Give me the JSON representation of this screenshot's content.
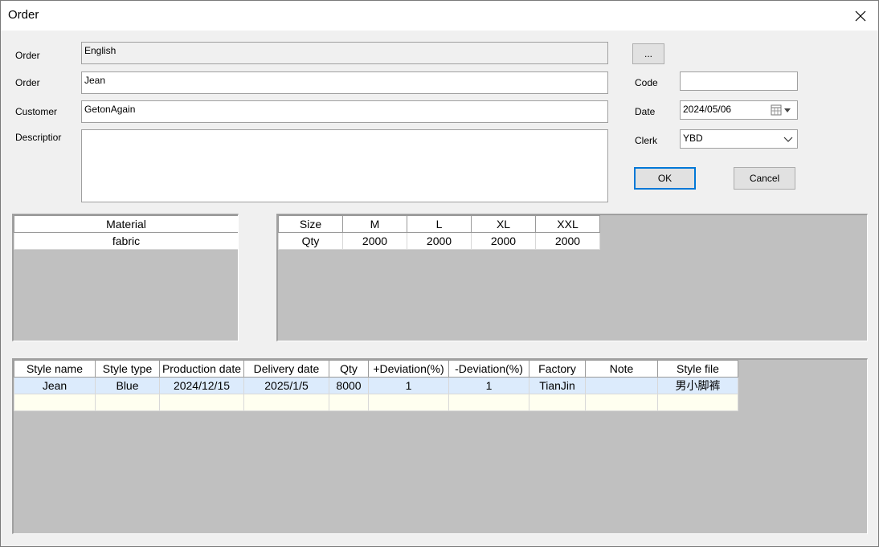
{
  "window": {
    "title": "Order"
  },
  "form": {
    "order_label_1": "Order",
    "order_value_1": "English",
    "browse_label": "...",
    "order_label_2": "Order",
    "order_value_2": "Jean",
    "customer_label": "Customer",
    "customer_value": "GetonAgain",
    "description_label": "Descriptior",
    "description_value": "",
    "code_label": "Code",
    "code_value": "",
    "date_label": "Date",
    "date_value": "2024/05/06",
    "clerk_label": "Clerk",
    "clerk_value": "YBD",
    "ok_label": "OK",
    "cancel_label": "Cancel"
  },
  "material_grid": {
    "header": "Material",
    "rows": [
      "fabric"
    ]
  },
  "size_grid": {
    "headers": [
      "Size",
      "M",
      "L",
      "XL",
      "XXL"
    ],
    "row": [
      "Qty",
      "2000",
      "2000",
      "2000",
      "2000"
    ]
  },
  "style_grid": {
    "headers": [
      "Style name",
      "Style type",
      "Production date",
      "Delivery date",
      "Qty",
      "+Deviation(%)",
      "-Deviation(%)",
      "Factory",
      "Note",
      "Style file"
    ],
    "rows": [
      [
        "Jean",
        "Blue",
        "2024/12/15",
        "2025/1/5",
        "8000",
        "1",
        "1",
        "TianJin",
        "",
        "男小脚裤"
      ]
    ]
  }
}
